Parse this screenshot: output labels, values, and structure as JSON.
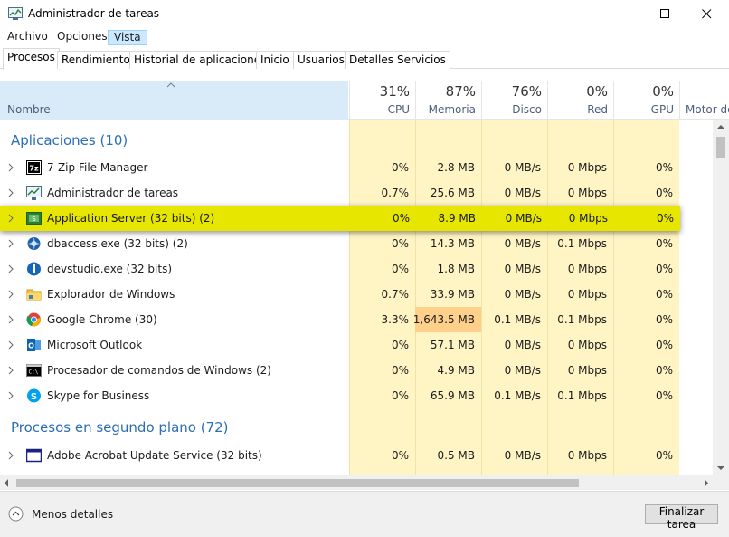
{
  "window": {
    "title": "Administrador de tareas"
  },
  "menu": {
    "archivo": "Archivo",
    "opciones": "Opciones",
    "vista": "Vista"
  },
  "tabs": [
    "Procesos",
    "Rendimiento",
    "Historial de aplicaciones",
    "Inicio",
    "Usuarios",
    "Detalles",
    "Servicios"
  ],
  "header": {
    "name": "Nombre",
    "cpu": {
      "pct": "31%",
      "label": "CPU"
    },
    "mem": {
      "pct": "87%",
      "label": "Memoria"
    },
    "disk": {
      "pct": "76%",
      "label": "Disco"
    },
    "net": {
      "pct": "0%",
      "label": "Red"
    },
    "gpu": {
      "pct": "0%",
      "label": "GPU"
    },
    "engine": {
      "label": "Motor de"
    }
  },
  "groups": {
    "apps": "Aplicaciones (10)",
    "background": "Procesos en segundo plano (72)"
  },
  "rows": [
    {
      "name": "7-Zip File Manager",
      "icon": "7zip-icon",
      "cpu": "0%",
      "mem": "2.8 MB",
      "disk": "0 MB/s",
      "net": "0 Mbps",
      "gpu": "0%"
    },
    {
      "name": "Administrador de tareas",
      "icon": "task-manager-icon",
      "cpu": "0.7%",
      "mem": "25.6 MB",
      "disk": "0 MB/s",
      "net": "0 Mbps",
      "gpu": "0%"
    },
    {
      "name": "Application Server (32 bits) (2)",
      "icon": "app-server-icon",
      "cpu": "0%",
      "mem": "8.9 MB",
      "disk": "0 MB/s",
      "net": "0 Mbps",
      "gpu": "0%"
    },
    {
      "name": "dbaccess.exe (32 bits) (2)",
      "icon": "dbaccess-icon",
      "cpu": "0%",
      "mem": "14.3 MB",
      "disk": "0 MB/s",
      "net": "0.1 Mbps",
      "gpu": "0%"
    },
    {
      "name": "devstudio.exe (32 bits)",
      "icon": "devstudio-icon",
      "cpu": "0%",
      "mem": "1.8 MB",
      "disk": "0 MB/s",
      "net": "0 Mbps",
      "gpu": "0%"
    },
    {
      "name": "Explorador de Windows",
      "icon": "folder-icon",
      "cpu": "0.7%",
      "mem": "33.9 MB",
      "disk": "0 MB/s",
      "net": "0 Mbps",
      "gpu": "0%"
    },
    {
      "name": "Google Chrome (30)",
      "icon": "chrome-icon",
      "cpu": "3.3%",
      "mem": "1,643.5 MB",
      "disk": "0.1 MB/s",
      "net": "0.1 Mbps",
      "gpu": "0%"
    },
    {
      "name": "Microsoft Outlook",
      "icon": "outlook-icon",
      "cpu": "0%",
      "mem": "57.1 MB",
      "disk": "0 MB/s",
      "net": "0 Mbps",
      "gpu": "0%"
    },
    {
      "name": "Procesador de comandos de Windows (2)",
      "icon": "cmd-icon",
      "cpu": "0%",
      "mem": "4.9 MB",
      "disk": "0 MB/s",
      "net": "0 Mbps",
      "gpu": "0%"
    },
    {
      "name": "Skype for Business",
      "icon": "skype-icon",
      "cpu": "0%",
      "mem": "65.9 MB",
      "disk": "0.1 MB/s",
      "net": "0.1 Mbps",
      "gpu": "0%"
    },
    {
      "name": "Adobe Acrobat Update Service (32 bits)",
      "icon": "acrobat-update-icon",
      "cpu": "0%",
      "mem": "0.5 MB",
      "disk": "0 MB/s",
      "net": "0 Mbps",
      "gpu": "0%"
    }
  ],
  "footer": {
    "less_details": "Menos detalles",
    "end_task": "Finalizar tarea"
  },
  "colors": {
    "selected_row": "#e6e600",
    "heat_light": "#fff4c4",
    "heat_high": "#ffd08a",
    "group_title": "#2b6eb3"
  }
}
